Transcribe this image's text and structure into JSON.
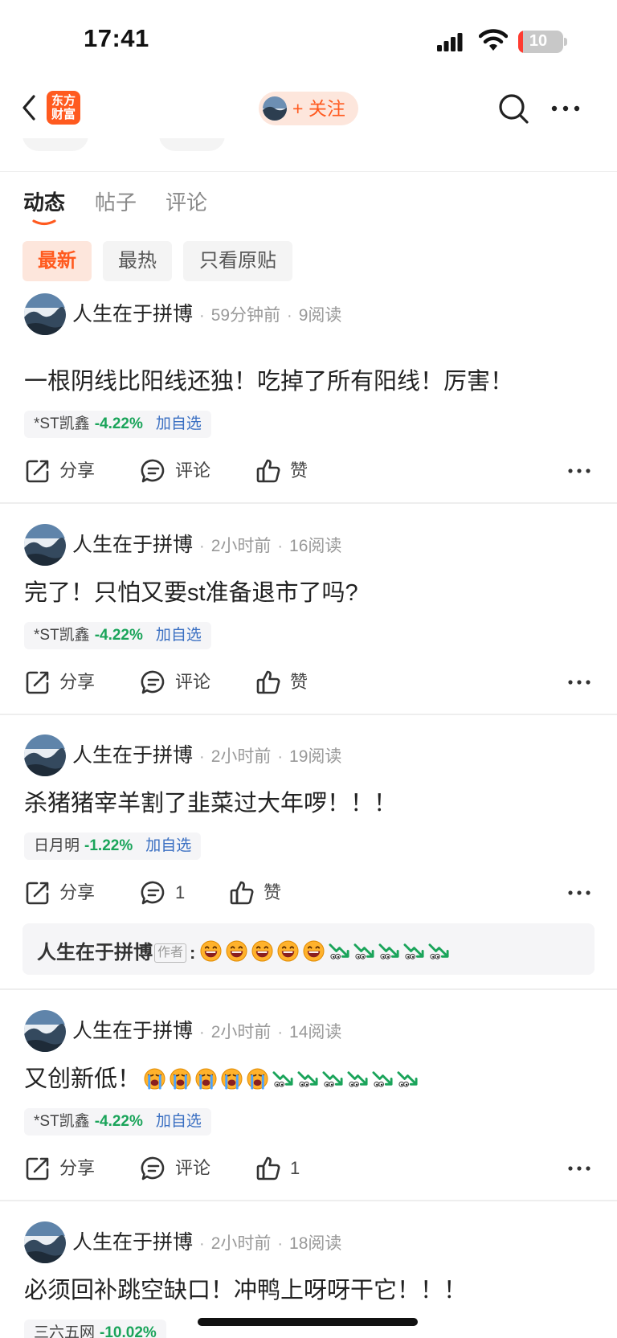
{
  "status_bar": {
    "time": "17:41",
    "battery": "10",
    "battery_level": 0.1
  },
  "nav": {
    "logo_text": "东方财富",
    "follow_label": "+ 关注"
  },
  "tabs": [
    {
      "label": "动态",
      "active": true
    },
    {
      "label": "帖子",
      "active": false
    },
    {
      "label": "评论",
      "active": false
    }
  ],
  "filters": [
    {
      "label": "最新",
      "active": true
    },
    {
      "label": "最热",
      "active": false
    },
    {
      "label": "只看原贴",
      "active": false
    }
  ],
  "colors": {
    "accent": "#ff5a1f",
    "accent_bg": "#fde6dc",
    "down_green": "#1aa45a",
    "link_blue": "#3a6fc2"
  },
  "actions_labels": {
    "share": "分享",
    "comment": "评论",
    "like": "赞"
  },
  "posts": [
    {
      "author": "人生在于拼博",
      "time": "59分钟前",
      "reads": "9阅读",
      "content": "一根阴线比阳线还独！吃掉了所有阳线！厉害！",
      "stock": {
        "name": "*ST凯鑫",
        "change": "-4.22%",
        "add_label": "加自选"
      },
      "comment_label": "评论",
      "like_label": "赞"
    },
    {
      "author": "人生在于拼博",
      "time": "2小时前",
      "reads": "16阅读",
      "content": "完了！只怕又要st准备退市了吗?",
      "stock": {
        "name": "*ST凯鑫",
        "change": "-4.22%",
        "add_label": "加自选"
      },
      "comment_label": "评论",
      "like_label": "赞"
    },
    {
      "author": "人生在于拼博",
      "time": "2小时前",
      "reads": "19阅读",
      "content": "杀猪猪宰羊割了韭菜过大年啰！！！",
      "stock": {
        "name": "日月明",
        "change": "-1.22%",
        "add_label": "加自选"
      },
      "comment_label": "1",
      "like_label": "赞",
      "reply": {
        "author": "人生在于拼博",
        "author_tag": "作者",
        "laugh_emoji_count": 5,
        "down_trend_emoji_count": 5
      }
    },
    {
      "author": "人生在于拼博",
      "time": "2小时前",
      "reads": "14阅读",
      "content": "又创新低！",
      "content_emojis": {
        "crying_count": 5,
        "down_trend_count": 6
      },
      "stock": {
        "name": "*ST凯鑫",
        "change": "-4.22%",
        "add_label": "加自选"
      },
      "comment_label": "评论",
      "like_label": "1"
    },
    {
      "author": "人生在于拼博",
      "time": "2小时前",
      "reads": "18阅读",
      "content": "必须回补跳空缺口！冲鸭上呀呀干它！！！",
      "stock": {
        "name": "三六五网",
        "change": "-10.02%",
        "add_label": ""
      }
    }
  ]
}
